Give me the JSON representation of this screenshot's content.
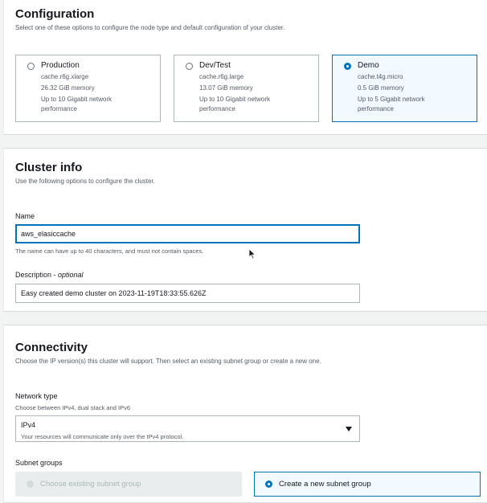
{
  "configuration": {
    "title": "Configuration",
    "description": "Select one of these options to configure the node type and default configuration of your cluster.",
    "options": [
      {
        "label": "Production",
        "node_type": "cache.r6g.xlarge",
        "memory": "26.32 GiB memory",
        "network_1": "Up to 10 Gigabit network",
        "network_2": "performance",
        "selected": false
      },
      {
        "label": "Dev/Test",
        "node_type": "cache.r6g.large",
        "memory": "13.07 GiB memory",
        "network_1": "Up to 10 Gigabit network",
        "network_2": "performance",
        "selected": false
      },
      {
        "label": "Demo",
        "node_type": "cache.t4g.micro",
        "memory": "0.5 GiB memory",
        "network_1": "Up to 5 Gigabit network",
        "network_2": "performance",
        "selected": true
      }
    ]
  },
  "cluster_info": {
    "title": "Cluster info",
    "description": "Use the following options to configure the cluster.",
    "name_label": "Name",
    "name_value": "aws_elasiccache",
    "name_hint": "The name can have up to 40 characters, and must not contain spaces.",
    "description_label": "Description - ",
    "description_optional": "optional",
    "description_value": "Easy created demo cluster on 2023-11-19T18:33:55.626Z"
  },
  "connectivity": {
    "title": "Connectivity",
    "description": "Choose the IP version(s) this cluster will support. Then select an existing subnet group or create a new one.",
    "network_type_label": "Network type",
    "network_type_hint": "Choose between IPv4, dual stack and IPv6",
    "network_type_value": "IPv4",
    "network_type_value_desc": "Your resources will communicate only over the IPv4 protocol.",
    "subnet_groups_label": "Subnet groups",
    "subnet_options": [
      {
        "label": "Choose existing subnet group",
        "selected": false,
        "disabled": true
      },
      {
        "label": "Create a new subnet group",
        "selected": true,
        "disabled": false
      }
    ]
  },
  "colors": {
    "accent": "#0073bb",
    "selected_bg": "#f1faff",
    "border": "#aab7b8",
    "text": "#16191f",
    "muted_text": "#545b64"
  }
}
